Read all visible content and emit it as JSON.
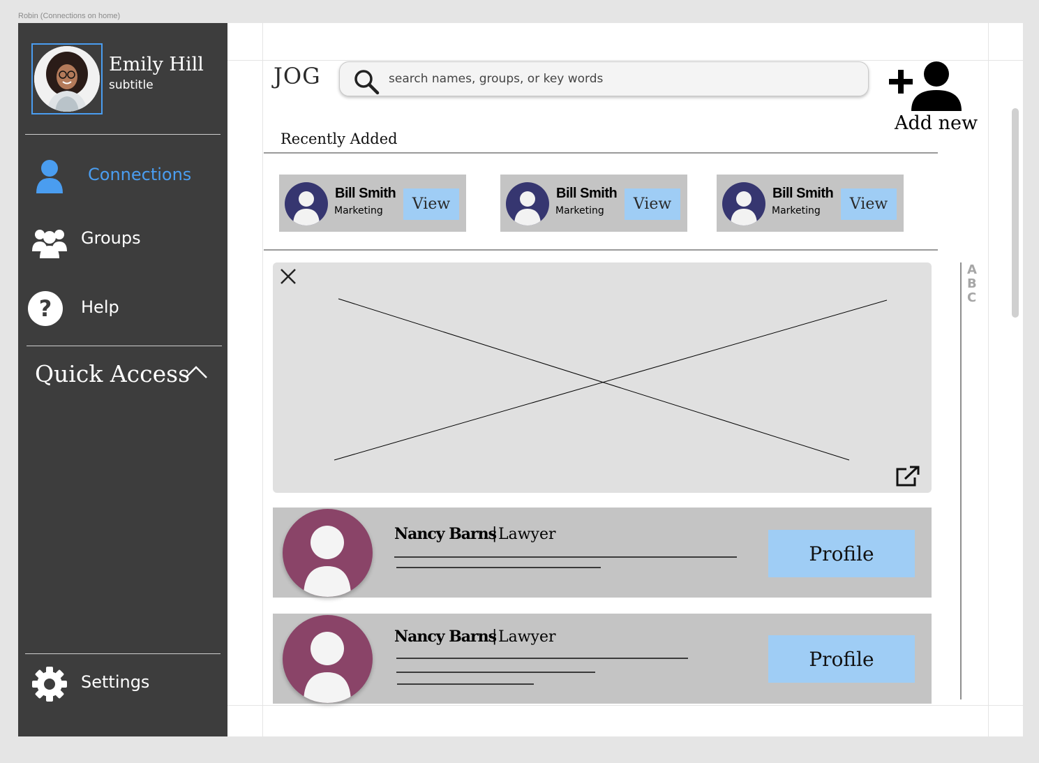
{
  "frame_label": "Robin (Connections on home)",
  "user": {
    "name": "Emily Hill",
    "subtitle": "subtitle"
  },
  "nav": {
    "connections": "Connections",
    "groups": "Groups",
    "help": "Help",
    "quick_access": "Quick Access",
    "settings": "Settings"
  },
  "colors": {
    "sidebar_bg": "#3d3d3d",
    "active_nav": "#4a9df0",
    "button_blue": "#9fcdf5",
    "mini_avatar": "#363670",
    "conn_avatar": "#8a4468"
  },
  "header": {
    "logo": "JOG",
    "search_placeholder": "search names, groups, or key words",
    "add_new": "Add new"
  },
  "recent": {
    "title": "Recently Added",
    "cards": [
      {
        "name": "Bill Smith",
        "role": "Marketing",
        "button": "View"
      },
      {
        "name": "Bill Smith",
        "role": "Marketing",
        "button": "View"
      },
      {
        "name": "Bill Smith",
        "role": "Marketing",
        "button": "View"
      }
    ]
  },
  "alphabet": [
    "A",
    "B",
    "C"
  ],
  "connections": [
    {
      "name": "Nancy Barns",
      "separator": "|",
      "role": "Lawyer",
      "button": "Profile"
    },
    {
      "name": "Nancy Barns",
      "separator": "|",
      "role": "Lawyer",
      "button": "Profile"
    }
  ]
}
